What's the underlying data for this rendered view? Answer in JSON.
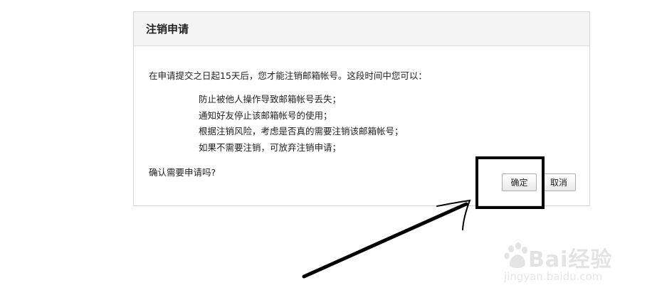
{
  "dialog": {
    "title": "注销申请",
    "intro": "在申请提交之日起15天后，您才能注销邮箱帐号。这段时间中您可以：",
    "items": [
      "防止被他人操作导致邮箱帐号丢失；",
      "通知好友停止该邮箱帐号的使用；",
      "根据注销风险，考虑是否真的需要注销该邮箱帐号；",
      "如果不需要注销，可放弃注销申请；"
    ],
    "question": "确认需要申请吗?",
    "ok_label": "确定",
    "cancel_label": "取消"
  },
  "watermark": {
    "logo": "Bai经验",
    "site": "jingyan.baidu.com"
  },
  "annotation": {
    "color": "#000000"
  }
}
